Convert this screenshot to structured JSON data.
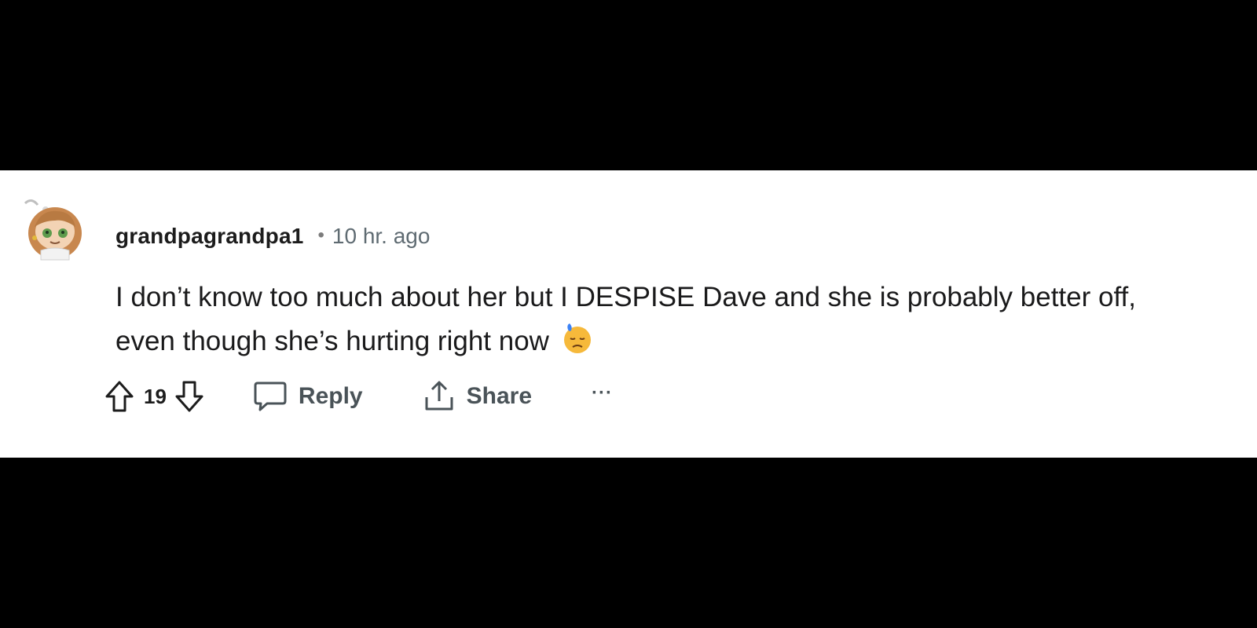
{
  "comment": {
    "username": "grandpagrandpa1",
    "separator": "•",
    "timestamp": "10 hr. ago",
    "body_line1": "I don’t know too much about her but I DESPISE Dave and she is probably better off,",
    "body_line2": "even though she’s hurting right now",
    "emoji_icon": "sad-sweat-face-icon"
  },
  "actions": {
    "upvote_icon": "upvote-arrow-icon",
    "vote_count": "19",
    "downvote_icon": "downvote-arrow-icon",
    "reply_label": "Reply",
    "share_label": "Share",
    "more_label": "···"
  },
  "colors": {
    "letterbox": "#000000",
    "panel": "#ffffff",
    "text": "#1a1a1b",
    "muted": "#5f6b72"
  }
}
